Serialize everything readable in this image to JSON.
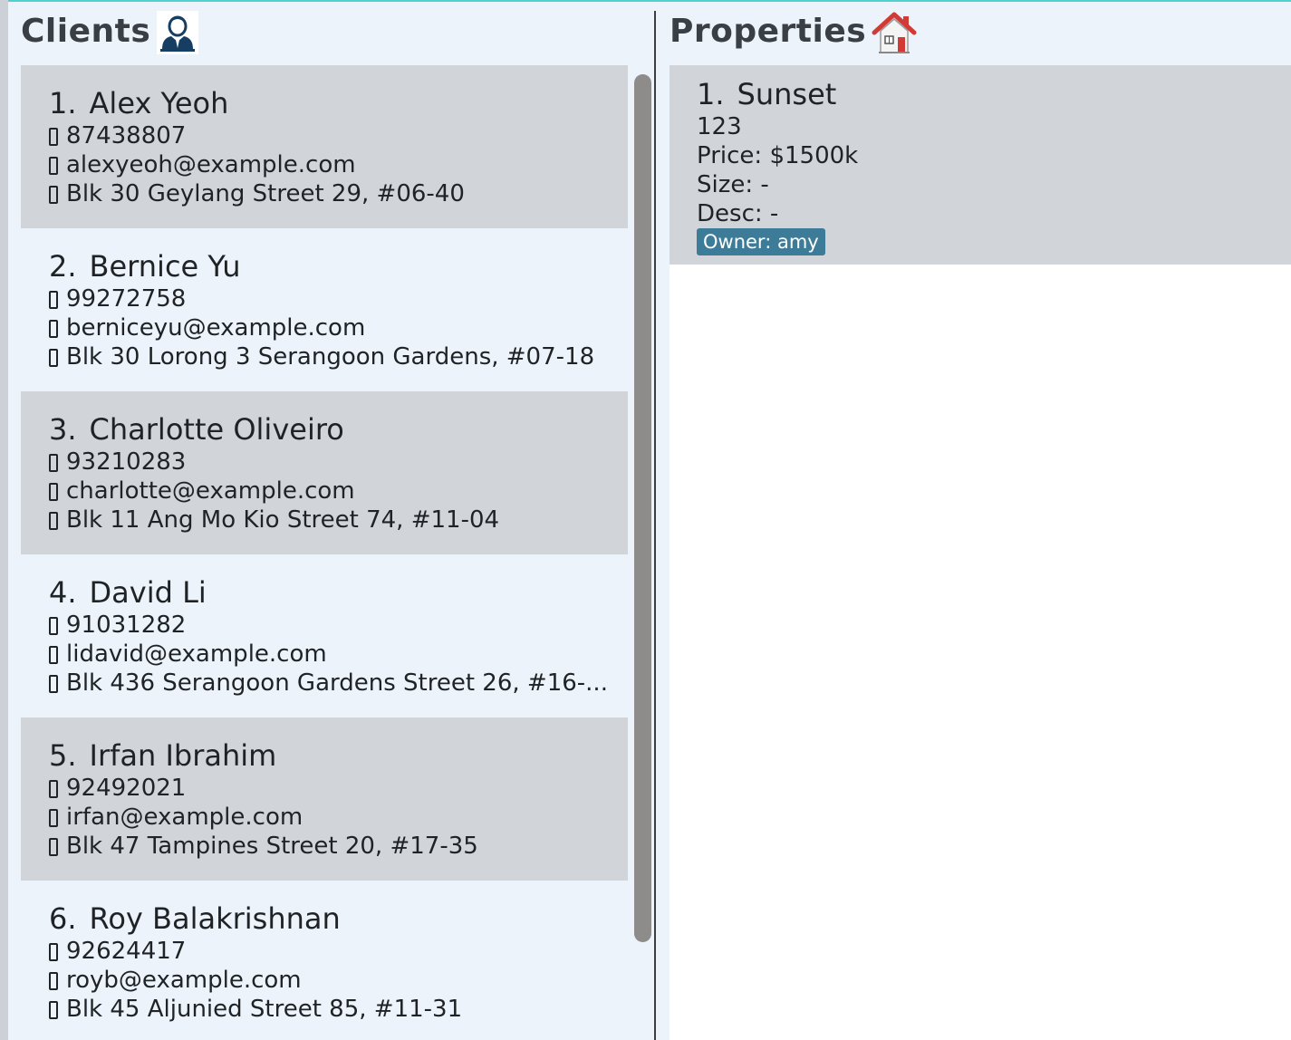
{
  "clients_panel": {
    "title": "Clients",
    "icon": "client-person-icon",
    "clients": [
      {
        "index": "1.",
        "name": "Alex Yeoh",
        "phone": "87438807",
        "email": "alexyeoh@example.com",
        "address": "Blk 30 Geylang Street 29, #06-40"
      },
      {
        "index": "2.",
        "name": "Bernice Yu",
        "phone": "99272758",
        "email": "berniceyu@example.com",
        "address": "Blk 30 Lorong 3 Serangoon Gardens, #07-18"
      },
      {
        "index": "3.",
        "name": "Charlotte Oliveiro",
        "phone": "93210283",
        "email": "charlotte@example.com",
        "address": "Blk 11 Ang Mo Kio Street 74, #11-04"
      },
      {
        "index": "4.",
        "name": "David Li",
        "phone": "91031282",
        "email": "lidavid@example.com",
        "address": "Blk 436 Serangoon Gardens Street 26, #16-..."
      },
      {
        "index": "5.",
        "name": "Irfan Ibrahim",
        "phone": "92492021",
        "email": "irfan@example.com",
        "address": "Blk 47 Tampines Street 20, #17-35"
      },
      {
        "index": "6.",
        "name": "Roy Balakrishnan",
        "phone": "92624417",
        "email": "royb@example.com",
        "address": "Blk 45 Aljunied Street 85, #11-31"
      }
    ]
  },
  "properties_panel": {
    "title": "Properties",
    "icon": "house-icon",
    "properties": [
      {
        "index": "1.",
        "name": "Sunset",
        "address": "123",
        "price": "Price: $1500k",
        "size": "Size: -",
        "desc": "Desc: -",
        "owner_tag": "Owner: amy"
      }
    ]
  },
  "colors": {
    "background": "#edf3fa",
    "card_alt": "#d1d5da",
    "owner_tag": "#3d7c98",
    "scroll_thumb": "#8e8b8b",
    "top_accent": "#4fd2cf"
  }
}
